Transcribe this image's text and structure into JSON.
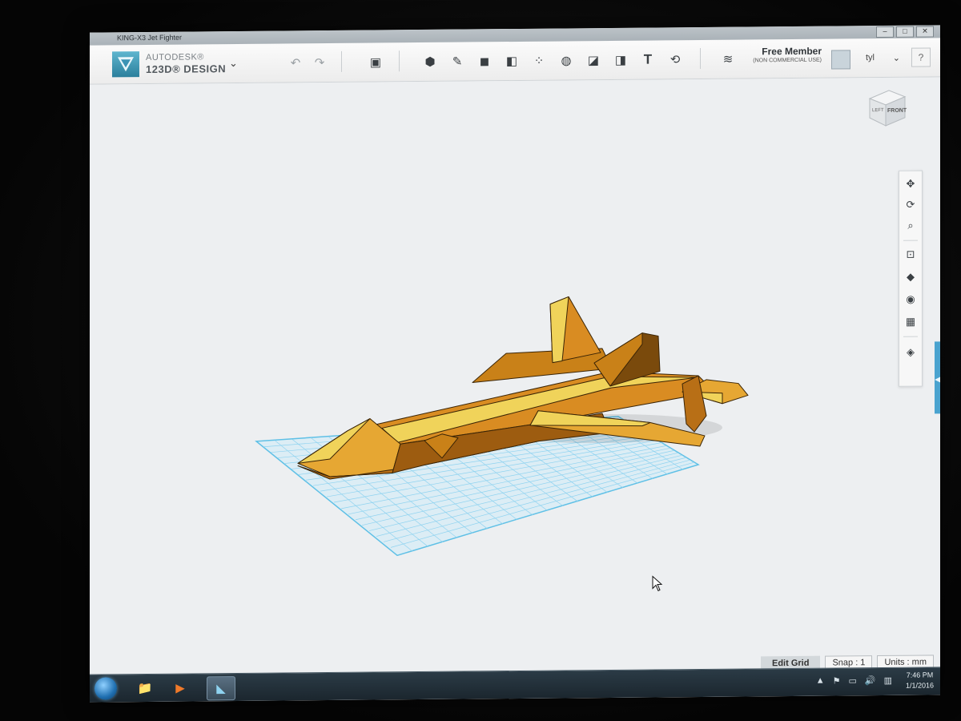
{
  "window": {
    "title": "KING-X3 Jet Fighter",
    "controls": [
      "–",
      "□",
      "✕"
    ]
  },
  "brand": {
    "line1": "AUTODESK®",
    "line2": "123D® DESIGN",
    "caret": "⌄"
  },
  "toolbar": {
    "undo_icon": "↶",
    "redo_icon": "↷",
    "tools": [
      {
        "name": "primitives-tool",
        "icon": "▣"
      },
      {
        "name": "sketch-tool",
        "icon": "⬢"
      },
      {
        "name": "construct-tool",
        "icon": "✎"
      },
      {
        "name": "modify-tool",
        "icon": "◼"
      },
      {
        "name": "pattern-tool",
        "icon": "◧"
      },
      {
        "name": "grouping-tool",
        "icon": "⁘"
      },
      {
        "name": "combine-tool",
        "icon": "◍"
      },
      {
        "name": "measure-tool",
        "icon": "◪"
      },
      {
        "name": "snap-tool",
        "icon": "◨"
      },
      {
        "name": "text-tool",
        "icon": "T"
      },
      {
        "name": "material-tool",
        "icon": "⟲"
      }
    ]
  },
  "account": {
    "plan": "Free Member",
    "plan_note": "(NON COMMERCIAL USE)",
    "username": "tyl",
    "caret": "⌄",
    "help": "?"
  },
  "viewcube": {
    "left_label": "LEFT",
    "front_label": "FRONT"
  },
  "navbar": {
    "icons": [
      "✥",
      "⟳",
      "⌕",
      "⊡",
      "◆",
      "◉",
      "▦",
      "◈"
    ]
  },
  "statusbar": {
    "edit_grid": "Edit Grid",
    "snap": "Snap : 1",
    "units": "Units : mm"
  },
  "taskbar": {
    "apps": [
      "📁",
      "▶",
      "◣"
    ],
    "tray_icons": [
      "▲",
      "⚑",
      "▭",
      "🔊",
      "▥"
    ],
    "time": "7:46 PM",
    "date": "1/1/2016"
  },
  "colors": {
    "accent": "#4aa3cf",
    "model_dark": "#b86f16",
    "model_mid": "#d98c22",
    "model_light": "#f0d35a",
    "grid": "#8fd3f0"
  }
}
